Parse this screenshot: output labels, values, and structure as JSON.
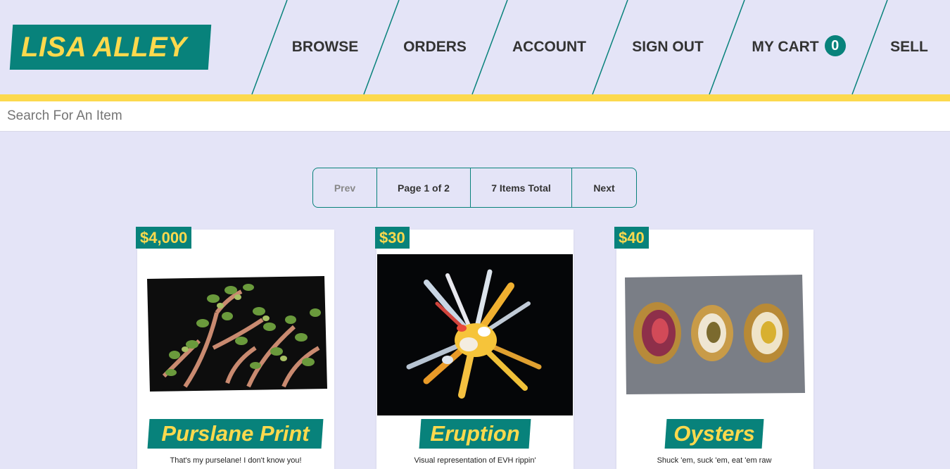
{
  "brand": {
    "name": "LISA ALLEY"
  },
  "nav": {
    "browse": "BROWSE",
    "orders": "ORDERS",
    "account": "ACCOUNT",
    "sign_out": "SIGN OUT",
    "cart": "MY CART",
    "cart_count": "0",
    "sell": "SELL"
  },
  "search": {
    "placeholder": "Search For An Item",
    "value": ""
  },
  "pagination": {
    "prev": "Prev",
    "page": "Page 1 of 2",
    "total": "7 Items Total",
    "next": "Next"
  },
  "items": [
    {
      "price": "$4,000",
      "title": "Purslane Print",
      "description": "That's my purselane! I don't know you!"
    },
    {
      "price": "$30",
      "title": "Eruption",
      "description": "Visual representation of EVH rippin'"
    },
    {
      "price": "$40",
      "title": "Oysters",
      "description": "Shuck 'em, suck 'em, eat 'em raw"
    }
  ],
  "colors": {
    "accent": "#08827b",
    "highlight": "#fcd94d",
    "background": "#e4e4f7"
  }
}
